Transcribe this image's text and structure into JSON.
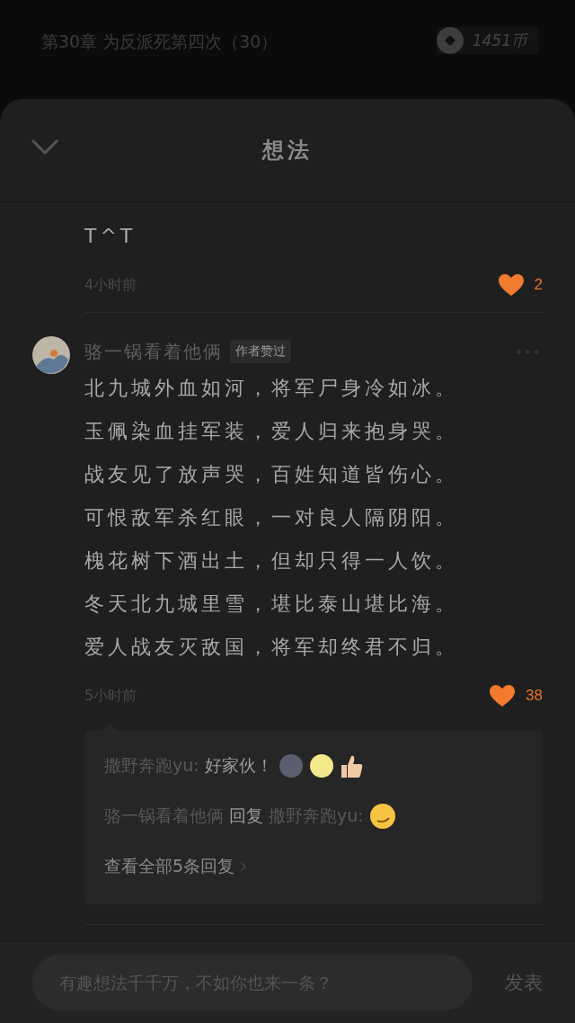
{
  "background": {
    "chapter_title": "第30章 为反派死第四次（30）",
    "coins": "1451币"
  },
  "sheet": {
    "title": "想法",
    "expanded": true
  },
  "comments": [
    {
      "text_lines": [
        "T^T"
      ],
      "time": "4小时前",
      "likes": "2",
      "liked": true
    },
    {
      "author": "骆一锅看着他俩",
      "badge": "作者赞过",
      "text_lines": [
        "北九城外血如河，将军尸身冷如冰。",
        "玉佩染血挂军装，爱人归来抱身哭。",
        "战友见了放声哭，百姓知道皆伤心。",
        "可恨敌军杀红眼，一对良人隔阴阳。",
        "槐花树下酒出土，但却只得一人饮。",
        "冬天北九城里雪，堪比泰山堪比海。",
        "爱人战友灭敌国，将军却终君不归。"
      ],
      "time": "5小时前",
      "likes": "38",
      "liked": true,
      "replies": [
        {
          "from": "撒野奔跑yu:",
          "text": "好家伙！",
          "icons": [
            {
              "kind": "dark-moon"
            },
            {
              "kind": "full-moon"
            },
            {
              "kind": "thumbs-up"
            }
          ]
        },
        {
          "from": "骆一锅看着他俩",
          "verb": "回复",
          "to": "撒野奔跑yu:",
          "icons": [
            {
              "kind": "smirk"
            }
          ]
        }
      ],
      "more_replies": "查看全部5条回复"
    }
  ],
  "composer": {
    "placeholder": "有趣想法千千万，不如你也来一条？",
    "send": "发表"
  }
}
